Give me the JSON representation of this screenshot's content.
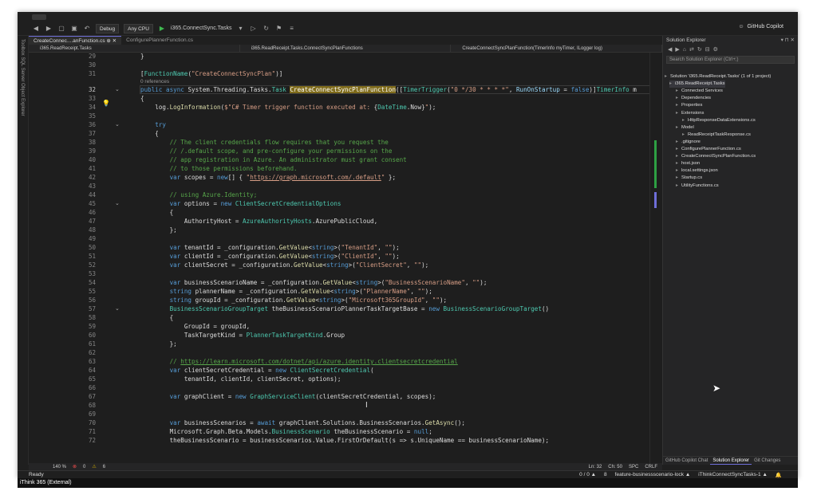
{
  "toolbar": {
    "config": "Debug",
    "platform": "Any CPU",
    "run_target": "i365.ConnectSync.Tasks",
    "copilot": "GitHub Copilot"
  },
  "leftstrip": {
    "label": "Toolbox   SQL Server Object Explorer"
  },
  "tabs": [
    {
      "label": "CreateConnec....anFunction.cs",
      "active": true
    },
    {
      "label": "ConfigurePlannerFunction.cs",
      "active": false
    }
  ],
  "navbar": {
    "project": "i365.ReadReceipt.Tasks",
    "class": "i365.ReadReceipt.Tasks.ConnectSyncPlanFunctions",
    "member": "CreateConnectSyncPlanFunction(TimerInfo myTimer, ILogger log)"
  },
  "code": {
    "l29": "}",
    "l31": "[FunctionName(\"CreateConnectSyncPlan\")]",
    "refs": "0 references",
    "l32a": "public async System.Threading.Tasks.Task ",
    "l32b": "CreateConnectSyncPlanFunction",
    "l32c": "([TimerTrigger(\"0 */30 * * * *\", RunOnStartup = false)]TimerInfo m",
    "l33": "{",
    "l34": "    log.LogInformation($\"C# Timer trigger function executed at: {DateTime.Now}\");",
    "l36": "    try",
    "l37": "    {",
    "l38": "        // The client credentials flow requires that you request the",
    "l39": "        // /.default scope, and pre-configure your permissions on the",
    "l40": "        // app registration in Azure. An administrator must grant consent",
    "l41": "        // to those permissions beforehand.",
    "l42a": "        var scopes = new[] { \"",
    "l42b": "https://graph.microsoft.com/.default",
    "l42c": "\" };",
    "l44": "        // using Azure.Identity;",
    "l45": "        var options = new ClientSecretCredentialOptions",
    "l46": "        {",
    "l47": "            AuthorityHost = AzureAuthorityHosts.AzurePublicCloud,",
    "l48": "        };",
    "l50": "        var tenantId = _configuration.GetValue<string>(\"TenantId\", \"\");",
    "l51": "        var clientId = _configuration.GetValue<string>(\"ClientId\", \"\");",
    "l52": "        var clientSecret = _configuration.GetValue<string>(\"ClientSecret\", \"\");",
    "l54": "        var businessScenarioName = _configuration.GetValue<string>(\"BusinessScenarioName\", \"\");",
    "l55": "        string plannerName = _configuration.GetValue<string>(\"PlannerName\", \"\");",
    "l56": "        string groupId = _configuration.GetValue<string>(\"Microsoft365GroupId\", \"\");",
    "l57": "        BusinessScenarioGroupTarget theBusinessScenarioPlannerTaskTargetBase = new BusinessScenarioGroupTarget()",
    "l58": "        {",
    "l59": "            GroupId = groupId,",
    "l60": "            TaskTargetKind = PlannerTaskTargetKind.Group",
    "l61": "        };",
    "l63a": "        // ",
    "l63b": "https://learn.microsoft.com/dotnet/api/azure.identity.clientsecretcredential",
    "l64": "        var clientSecretCredential = new ClientSecretCredential(",
    "l65": "            tenantId, clientId, clientSecret, options);",
    "l67": "        var graphClient = new GraphServiceClient(clientSecretCredential, scopes);",
    "l70": "        var businessScenarios = await graphClient.Solutions.BusinessScenarios.GetAsync();",
    "l71": "        Microsoft.Graph.Beta.Models.BusinessScenario theBusinessScenario = null;",
    "l72": "        theBusinessScenario = businessScenarios.Value.FirstOrDefault(s => s.UniqueName == businessScenarioName);"
  },
  "line_numbers": [
    "29",
    "30",
    "31",
    "32",
    "33",
    "34",
    "35",
    "36",
    "37",
    "38",
    "39",
    "40",
    "41",
    "42",
    "43",
    "44",
    "45",
    "46",
    "47",
    "48",
    "49",
    "50",
    "51",
    "52",
    "53",
    "54",
    "55",
    "56",
    "57",
    "58",
    "59",
    "60",
    "61",
    "62",
    "63",
    "64",
    "65",
    "66",
    "67",
    "68",
    "69",
    "70",
    "71",
    "72"
  ],
  "editor_status": {
    "zoom": "140 %",
    "errors": "0",
    "warnings": "6",
    "ln": "Ln: 32",
    "ch": "Ch: 50",
    "spc": "SPC",
    "crlf": "CRLF"
  },
  "solution_explorer": {
    "title": "Solution Explorer",
    "search_placeholder": "Search Solution Explorer (Ctrl+;)",
    "items": [
      "Solution 'i365.ReadReceipt.Tasks' (1 of 1 project)",
      "i365.ReadReceipt.Tasks",
      "Connected Services",
      "Dependencies",
      "Properties",
      "Extensions",
      "HttpResponseDataExtensions.cs",
      "Model",
      "ReadReceiptTaskResponse.cs",
      ".gitignore",
      "ConfigurePlannerFunction.cs",
      "CreateConnectSyncPlanFunction.cs",
      "host.json",
      "local.settings.json",
      "Startup.cs",
      "UtilityFunctions.cs"
    ],
    "tabs": [
      "GitHub Copilot Chat",
      "Solution Explorer",
      "Git Changes"
    ]
  },
  "statusbar": {
    "ready": "Ready",
    "git_counts": "0 / 0 ▲",
    "pencil": "8",
    "branch": "feature-businessscenario-lock ▲",
    "repo": "iThinkConnectSyncTasks-1 ▲"
  },
  "taskstrip": {
    "label": "iThink 365 (External)"
  }
}
